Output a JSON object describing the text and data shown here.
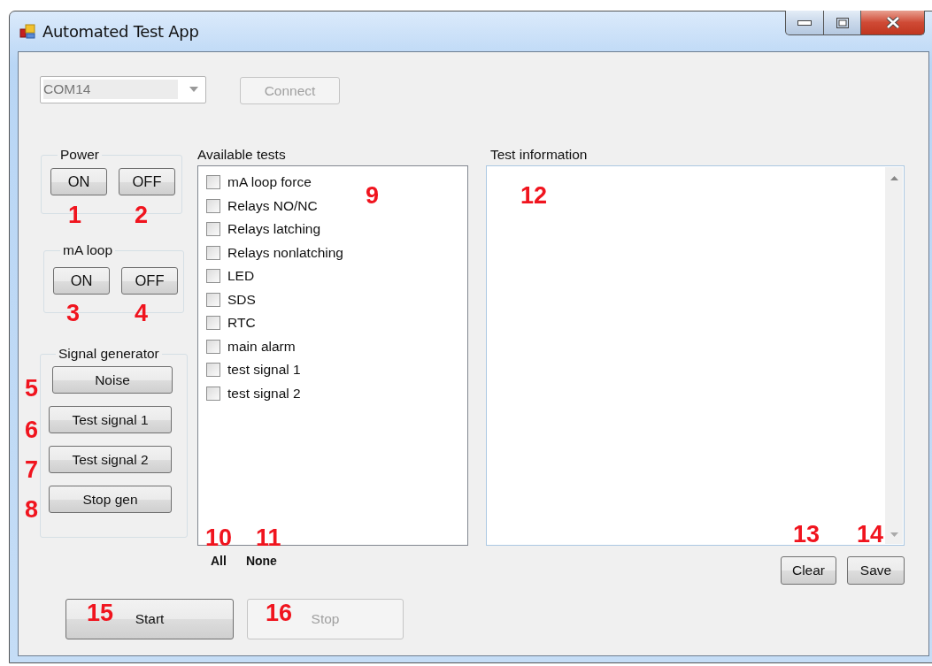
{
  "window": {
    "title": "Automated Test App"
  },
  "port": {
    "value": "COM14",
    "disabled": true
  },
  "connect": {
    "label": "Connect",
    "disabled": true
  },
  "groups": [
    {
      "title": "Power",
      "kind": "pair",
      "buttons": [
        "ON",
        "OFF"
      ]
    },
    {
      "title": "mA loop",
      "kind": "pair",
      "buttons": [
        "ON",
        "OFF"
      ]
    },
    {
      "title": "Signal generator",
      "kind": "stack",
      "buttons": [
        "Noise",
        "Test signal 1",
        "Test signal 2",
        "Stop gen"
      ]
    }
  ],
  "available_tests": {
    "label": "Available tests",
    "items": [
      {
        "label": "mA loop force",
        "checked": false
      },
      {
        "label": "Relays NO/NC",
        "checked": false
      },
      {
        "label": "Relays latching",
        "checked": false
      },
      {
        "label": "Relays nonlatching",
        "checked": false
      },
      {
        "label": "LED",
        "checked": false
      },
      {
        "label": "SDS",
        "checked": false
      },
      {
        "label": "RTC",
        "checked": false
      },
      {
        "label": "main alarm",
        "checked": false
      },
      {
        "label": "test signal 1",
        "checked": false
      },
      {
        "label": "test signal 2",
        "checked": false
      }
    ]
  },
  "select_links": [
    "All",
    "None"
  ],
  "test_information": {
    "label": "Test information"
  },
  "log_buttons": [
    "Clear",
    "Save"
  ],
  "run_buttons": [
    {
      "label": "Start",
      "disabled": false
    },
    {
      "label": "Stop",
      "disabled": true
    }
  ],
  "annotations": [
    "1",
    "2",
    "3",
    "4",
    "5",
    "6",
    "7",
    "8",
    "9",
    "10",
    "11",
    "12",
    "13",
    "14",
    "15",
    "16"
  ]
}
